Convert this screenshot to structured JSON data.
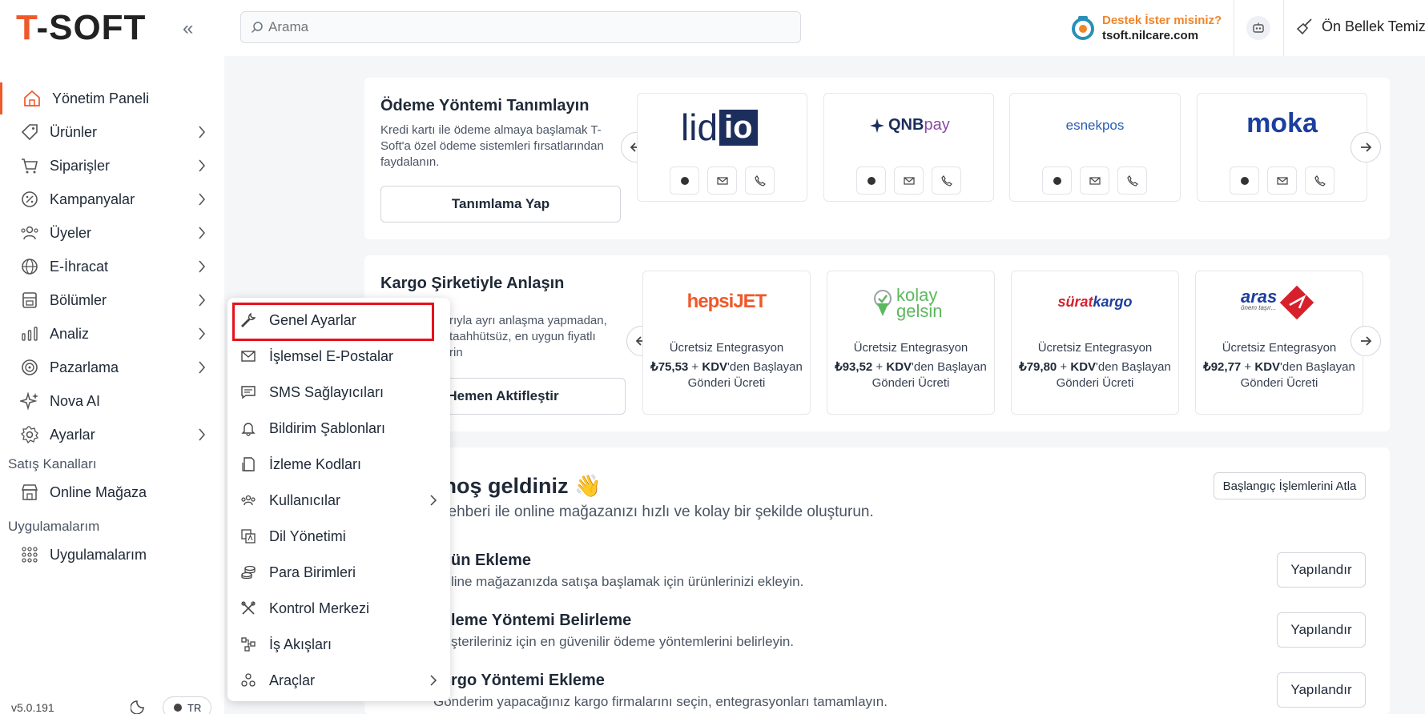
{
  "header": {
    "logo_first": "T",
    "logo_rest": "-SOFT",
    "collapse_glyph": "«",
    "search_placeholder": "Arama",
    "support_title": "Destek İster misiniz?",
    "support_url": "tsoft.nilcare.com",
    "cache_label": "Ön Bellek Temizle"
  },
  "sidebar": {
    "items": [
      {
        "label": "Yönetim Paneli",
        "icon": "home-icon"
      },
      {
        "label": "Ürünler",
        "icon": "tag-icon"
      },
      {
        "label": "Siparişler",
        "icon": "cart-icon"
      },
      {
        "label": "Kampanyalar",
        "icon": "discount-icon"
      },
      {
        "label": "Üyeler",
        "icon": "users-icon"
      },
      {
        "label": "E-İhracat",
        "icon": "globe-icon"
      },
      {
        "label": "Bölümler",
        "icon": "sections-icon"
      },
      {
        "label": "Analiz",
        "icon": "analytics-icon"
      },
      {
        "label": "Pazarlama",
        "icon": "target-icon"
      },
      {
        "label": "Nova AI",
        "icon": "sparkle-icon"
      },
      {
        "label": "Ayarlar",
        "icon": "gear-icon"
      }
    ],
    "section_sales": "Satış Kanalları",
    "online_store": "Online Mağaza",
    "section_apps": "Uygulamalarım",
    "apps": "Uygulamalarım",
    "version": "v5.0.191",
    "lang": "TR"
  },
  "settings_menu": {
    "items": [
      {
        "label": "Genel Ayarlar",
        "icon": "wrench-icon"
      },
      {
        "label": "İşlemsel E-Postalar",
        "icon": "mail-icon"
      },
      {
        "label": "SMS Sağlayıcıları",
        "icon": "sms-icon"
      },
      {
        "label": "Bildirim Şablonları",
        "icon": "bell-icon"
      },
      {
        "label": "İzleme Kodları",
        "icon": "code-file-icon"
      },
      {
        "label": "Kullanıcılar",
        "icon": "team-icon"
      },
      {
        "label": "Dil Yönetimi",
        "icon": "translate-icon"
      },
      {
        "label": "Para Birimleri",
        "icon": "coins-icon"
      },
      {
        "label": "Kontrol Merkezi",
        "icon": "tools-icon"
      },
      {
        "label": "İş Akışları",
        "icon": "workflow-icon"
      },
      {
        "label": "Araçlar",
        "icon": "apps-icon"
      }
    ]
  },
  "payment": {
    "title": "Ödeme Yöntemi Tanımlayın",
    "desc": "Kredi kartı ile ödeme almaya başlamak T-Soft'a özel ödeme sistemleri fırsatlarından faydalanın.",
    "button": "Tanımlama Yap",
    "providers": [
      {
        "part1": "lid",
        "part2": "io"
      },
      {
        "part1": "QNB",
        "part2": "pay"
      },
      {
        "part1": "esnekpos",
        "part2": ""
      },
      {
        "part1": "moka",
        "part2": ""
      }
    ]
  },
  "cargo": {
    "title": "Kargo Şirketiyle Anlaşın",
    "desc_line1": "rıyla ayrı anlaşma yapmadan,",
    "desc_line2": "taahhütsüz, en uygun fiyatlı",
    "desc_line3": "rin",
    "button": "Hemen Aktifleştir",
    "label": "Ücretsiz Entegrasyon",
    "kdv": "KDV",
    "suffix": "'den Başlayan",
    "line2": "Gönderi Ücreti",
    "companies": [
      {
        "part1": "hepsi",
        "part2": "JET",
        "price": "₺75,53"
      },
      {
        "part1": "kolay",
        "part2": "gelsin",
        "price": "₺93,52"
      },
      {
        "part1": "sürat",
        "part2": "kargo",
        "price": "₺79,80"
      },
      {
        "part1": "aras",
        "part2": "önem taşır...",
        "price": "₺92,77"
      }
    ]
  },
  "welcome": {
    "title": "a hoş geldiniz 👋",
    "subtitle": "ç Rehberi ile online mağazanızı hızlı ve kolay bir şekilde oluşturun.",
    "skip": "Başlangıç İşlemlerini Atla",
    "configure": "Yapılandır",
    "steps": [
      {
        "title": "ün Ekleme",
        "desc": "line mağazanızda satışa başlamak için ürünlerinizi ekleyin."
      },
      {
        "title": "leme Yöntemi Belirleme",
        "desc": "şterileriniz için en güvenilir ödeme yöntemlerini belirleyin."
      },
      {
        "title": "rgo Yöntemi Ekleme",
        "desc": "Gönderim yapacağınız kargo firmalarını seçin, entegrasyonları tamamlayın."
      }
    ]
  },
  "colors": {
    "brand": "#f0582a",
    "highlight": "#e5121b",
    "accent": "#f0852a"
  }
}
